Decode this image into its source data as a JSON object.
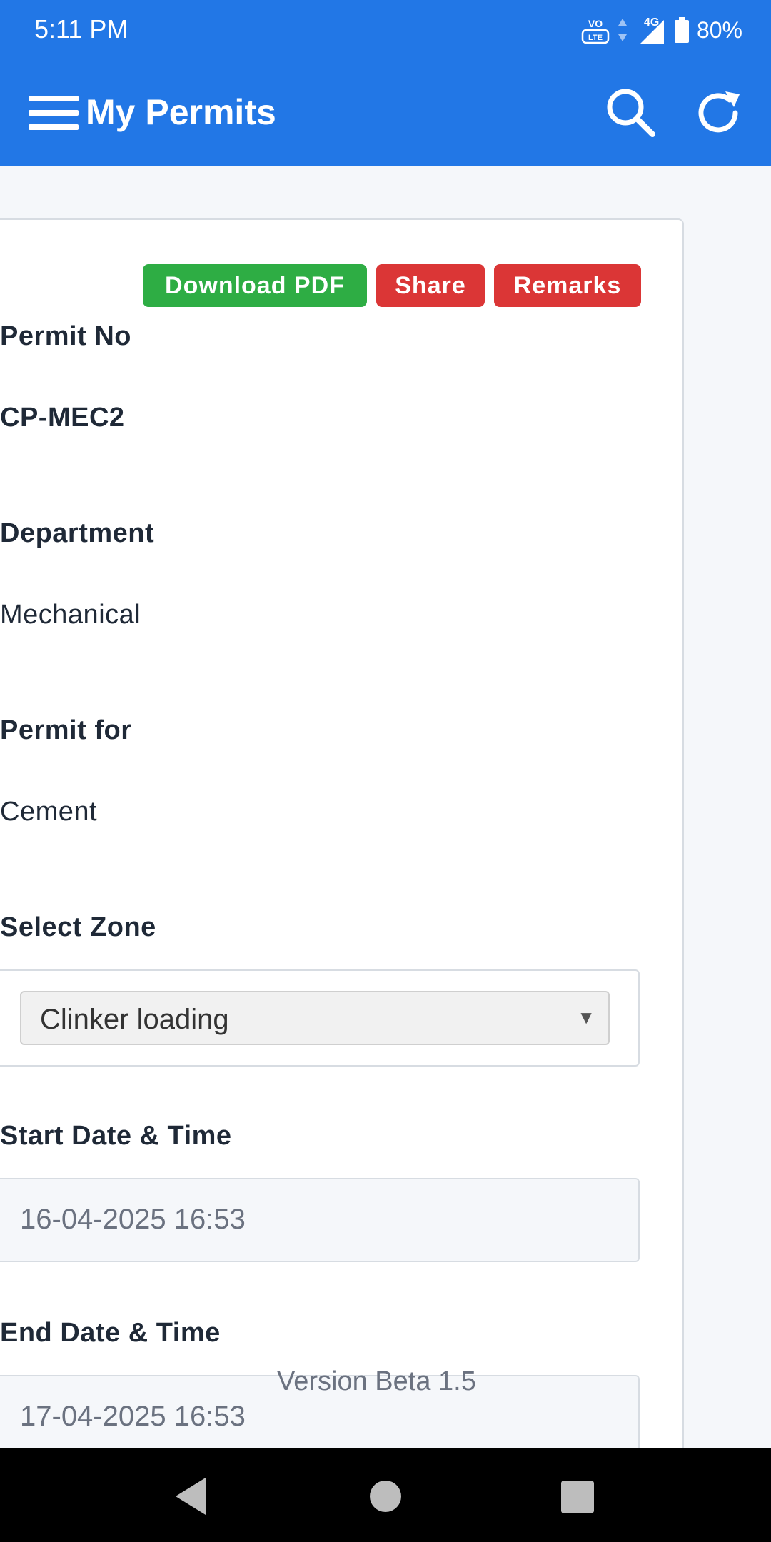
{
  "status_bar": {
    "time": "5:11 PM",
    "network_label": "4G",
    "volte_label": "VO LTE",
    "battery": "80%"
  },
  "app_bar": {
    "title": "My Permits",
    "icons": [
      "menu-icon",
      "search-icon",
      "refresh-icon"
    ]
  },
  "actions": {
    "download_pdf": "Download PDF",
    "share": "Share",
    "remarks": "Remarks"
  },
  "fields": {
    "permit_no_label": "Permit No",
    "permit_no_value": "CP-MEC2",
    "department_label": "Department",
    "department_value": "Mechanical",
    "permit_for_label": "Permit for",
    "permit_for_value": "Cement",
    "zone_label": "Select Zone",
    "zone_value": "Clinker loading",
    "start_label": "Start Date & Time",
    "start_value": "16-04-2025 16:53",
    "end_label": "End Date & Time",
    "end_value": "17-04-2025 16:53"
  },
  "footer": {
    "version": "Version Beta 1.5"
  },
  "colors": {
    "primary": "#2277e6",
    "success": "#2ead44",
    "danger": "#db3636"
  }
}
